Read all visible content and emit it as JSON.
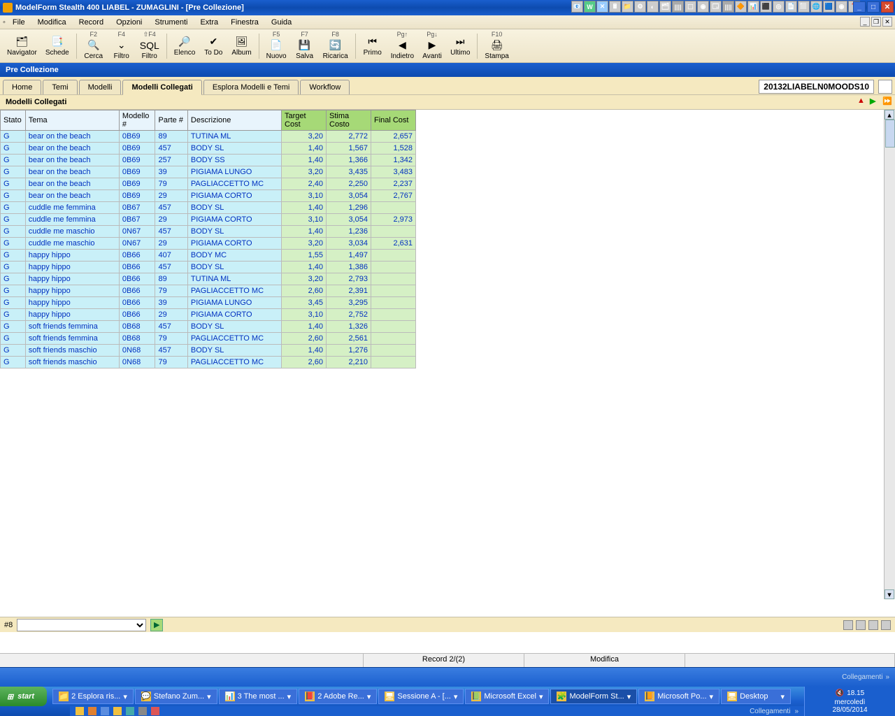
{
  "window": {
    "title": "ModelForm Stealth 400 LIABEL - ZUMAGLINI - [Pre Collezione]",
    "subtitle": "Pre Collezione"
  },
  "menubar": [
    "File",
    "Modifica",
    "Record",
    "Opzioni",
    "Strumenti",
    "Extra",
    "Finestra",
    "Guida"
  ],
  "toolbar": [
    {
      "label": "Navigator",
      "icon": "🗂"
    },
    {
      "label": "Schede",
      "icon": "📑"
    },
    {
      "sep": true
    },
    {
      "label": "Cerca",
      "icon": "🔍",
      "key": "F2"
    },
    {
      "label": "Filtro",
      "icon": "⌄",
      "key": "F4"
    },
    {
      "label": "Filtro",
      "icon": "SQL",
      "key": "⇧F4"
    },
    {
      "sep": true
    },
    {
      "label": "Elenco",
      "icon": "🔎"
    },
    {
      "label": "To Do",
      "icon": "✔"
    },
    {
      "label": "Album",
      "icon": "🖼"
    },
    {
      "sep": true
    },
    {
      "label": "Nuovo",
      "icon": "📄",
      "key": "F5"
    },
    {
      "label": "Salva",
      "icon": "💾",
      "key": "F7"
    },
    {
      "label": "Ricarica",
      "icon": "🔄",
      "key": "F8"
    },
    {
      "sep": true
    },
    {
      "label": "Primo",
      "icon": "⏮"
    },
    {
      "label": "Indietro",
      "icon": "◀",
      "key": "Pg↑"
    },
    {
      "label": "Avanti",
      "icon": "▶",
      "key": "Pg↓"
    },
    {
      "label": "Ultimo",
      "icon": "⏭"
    },
    {
      "sep": true
    },
    {
      "label": "Stampa",
      "icon": "🖨",
      "key": "F10"
    }
  ],
  "tabs": [
    "Home",
    "Temi",
    "Modelli",
    "Modelli Collegati",
    "Esplora Modelli e Temi",
    "Workflow"
  ],
  "active_tab": "Modelli Collegati",
  "season_code": "20132LIABELN0MOODS10",
  "section_title": "Modelli Collegati",
  "columns": [
    "Stato",
    "Tema",
    "Modello #",
    "Parte #",
    "Descrizione",
    "Target Cost",
    "Stima Costo",
    "Final Cost"
  ],
  "rows": [
    {
      "stato": "G",
      "tema": "bear on the beach",
      "modello": "0B69",
      "parte": "89",
      "descr": "TUTINA ML",
      "target": "3,20",
      "stima": "2,772",
      "final": "2,657"
    },
    {
      "stato": "G",
      "tema": "bear on the beach",
      "modello": "0B69",
      "parte": "457",
      "descr": "BODY SL",
      "target": "1,40",
      "stima": "1,567",
      "final": "1,528"
    },
    {
      "stato": "G",
      "tema": "bear on the beach",
      "modello": "0B69",
      "parte": "257",
      "descr": "BODY SS",
      "target": "1,40",
      "stima": "1,366",
      "final": "1,342"
    },
    {
      "stato": "G",
      "tema": "bear on the beach",
      "modello": "0B69",
      "parte": "39",
      "descr": "PIGIAMA LUNGO",
      "target": "3,20",
      "stima": "3,435",
      "final": "3,483"
    },
    {
      "stato": "G",
      "tema": "bear on the beach",
      "modello": "0B69",
      "parte": "79",
      "descr": "PAGLIACCETTO MC",
      "target": "2,40",
      "stima": "2,250",
      "final": "2,237"
    },
    {
      "stato": "G",
      "tema": "bear on the beach",
      "modello": "0B69",
      "parte": "29",
      "descr": "PIGIAMA CORTO",
      "target": "3,10",
      "stima": "3,054",
      "final": "2,767"
    },
    {
      "stato": "G",
      "tema": "cuddle me femmina",
      "modello": "0B67",
      "parte": "457",
      "descr": "BODY SL",
      "target": "1,40",
      "stima": "1,296",
      "final": ""
    },
    {
      "stato": "G",
      "tema": "cuddle me femmina",
      "modello": "0B67",
      "parte": "29",
      "descr": "PIGIAMA CORTO",
      "target": "3,10",
      "stima": "3,054",
      "final": "2,973"
    },
    {
      "stato": "G",
      "tema": "cuddle me maschio",
      "modello": "0N67",
      "parte": "457",
      "descr": "BODY SL",
      "target": "1,40",
      "stima": "1,236",
      "final": ""
    },
    {
      "stato": "G",
      "tema": "cuddle me maschio",
      "modello": "0N67",
      "parte": "29",
      "descr": "PIGIAMA CORTO",
      "target": "3,20",
      "stima": "3,034",
      "final": "2,631"
    },
    {
      "stato": "G",
      "tema": "happy hippo",
      "modello": "0B66",
      "parte": "407",
      "descr": "BODY MC",
      "target": "1,55",
      "stima": "1,497",
      "final": ""
    },
    {
      "stato": "G",
      "tema": "happy hippo",
      "modello": "0B66",
      "parte": "457",
      "descr": "BODY SL",
      "target": "1,40",
      "stima": "1,386",
      "final": ""
    },
    {
      "stato": "G",
      "tema": "happy hippo",
      "modello": "0B66",
      "parte": "89",
      "descr": "TUTINA ML",
      "target": "3,20",
      "stima": "2,793",
      "final": ""
    },
    {
      "stato": "G",
      "tema": "happy hippo",
      "modello": "0B66",
      "parte": "79",
      "descr": "PAGLIACCETTO MC",
      "target": "2,60",
      "stima": "2,391",
      "final": ""
    },
    {
      "stato": "G",
      "tema": "happy hippo",
      "modello": "0B66",
      "parte": "39",
      "descr": "PIGIAMA LUNGO",
      "target": "3,45",
      "stima": "3,295",
      "final": ""
    },
    {
      "stato": "G",
      "tema": "happy hippo",
      "modello": "0B66",
      "parte": "29",
      "descr": "PIGIAMA CORTO",
      "target": "3,10",
      "stima": "2,752",
      "final": ""
    },
    {
      "stato": "G",
      "tema": "soft friends femmina",
      "modello": "0B68",
      "parte": "457",
      "descr": "BODY SL",
      "target": "1,40",
      "stima": "1,326",
      "final": ""
    },
    {
      "stato": "G",
      "tema": "soft friends femmina",
      "modello": "0B68",
      "parte": "79",
      "descr": "PAGLIACCETTO MC",
      "target": "2,60",
      "stima": "2,561",
      "final": ""
    },
    {
      "stato": "G",
      "tema": "soft friends maschio",
      "modello": "0N68",
      "parte": "457",
      "descr": "BODY SL",
      "target": "1,40",
      "stima": "1,276",
      "final": ""
    },
    {
      "stato": "G",
      "tema": "soft friends maschio",
      "modello": "0N68",
      "parte": "79",
      "descr": "PAGLIACCETTO MC",
      "target": "2,60",
      "stima": "2,210",
      "final": ""
    }
  ],
  "record_num": "#8",
  "status": {
    "record": "Record 2/(2)",
    "mode": "Modifica"
  },
  "linkbar_label": "Collegamenti",
  "taskbar": {
    "start": "start",
    "items": [
      {
        "label": "2 Esplora ris...",
        "icon": "📁"
      },
      {
        "label": "Stefano Zum...",
        "icon": "💬"
      },
      {
        "label": "3 The most ...",
        "icon": "📊"
      },
      {
        "label": "2 Adobe Re...",
        "icon": "📕"
      },
      {
        "label": "Sessione A - [...",
        "icon": "🖥"
      },
      {
        "label": "Microsoft Excel",
        "icon": "📗"
      },
      {
        "label": "ModelForm St...",
        "icon": "🧩",
        "active": true
      },
      {
        "label": "Microsoft Po...",
        "icon": "📙"
      },
      {
        "label": "Desktop",
        "icon": "🖥"
      }
    ],
    "time": "18.15",
    "day": "mercoledì",
    "date": "28/05/2014"
  }
}
